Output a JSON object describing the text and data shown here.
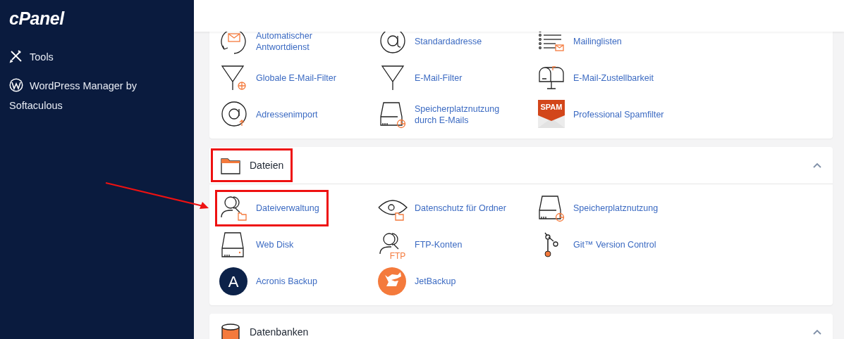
{
  "sidebar": {
    "logo": "cPanel",
    "items": [
      {
        "label": "Tools",
        "kind": "tools"
      },
      {
        "label": "WordPress Manager by Softaculous",
        "kind": "wordpress"
      }
    ]
  },
  "sections": [
    {
      "items": [
        {
          "label": "Automatischer Antwortdienst",
          "kind": "autoresponder",
          "highlighted": false
        },
        {
          "label": "Standardadresse",
          "kind": "at",
          "highlighted": false
        },
        {
          "label": "Mailinglisten",
          "kind": "mailinglist",
          "highlighted": false
        },
        {
          "label": "Globale E-Mail-Filter",
          "kind": "filterglobe",
          "highlighted": false
        },
        {
          "label": "E-Mail-Filter",
          "kind": "filter",
          "highlighted": false
        },
        {
          "label": "E-Mail-Zustellbarkeit",
          "kind": "mailbox",
          "highlighted": false
        },
        {
          "label": "Adressenimport",
          "kind": "atimport",
          "highlighted": false
        },
        {
          "label": "Speicherplatznutzung durch E-Mails",
          "kind": "diskchart",
          "highlighted": false
        },
        {
          "label": "Professional Spamfilter",
          "kind": "spam",
          "icon_text": "SPAM",
          "highlighted": false
        }
      ]
    },
    {
      "title": "Dateien",
      "kind": "folder",
      "expanded": true,
      "highlighted": true,
      "items": [
        {
          "label": "Dateiverwaltung",
          "kind": "userfolder",
          "highlighted": true,
          "arrow": true
        },
        {
          "label": "Datenschutz für Ordner",
          "kind": "eyefolder",
          "highlighted": false
        },
        {
          "label": "Speicherplatznutzung",
          "kind": "diskchart",
          "highlighted": false
        },
        {
          "label": "Web Disk",
          "kind": "disk",
          "highlighted": false
        },
        {
          "label": "FTP-Konten",
          "kind": "userftp",
          "icon_text": "FTP",
          "highlighted": false
        },
        {
          "label": "Git™ Version Control",
          "kind": "git",
          "highlighted": false
        },
        {
          "label": "Acronis Backup",
          "kind": "acronis",
          "icon_text": "A",
          "highlighted": false
        },
        {
          "label": "JetBackup",
          "kind": "jetbackup",
          "highlighted": false
        }
      ]
    },
    {
      "title": "Datenbanken",
      "kind": "database",
      "expanded": true,
      "highlighted": false
    }
  ]
}
